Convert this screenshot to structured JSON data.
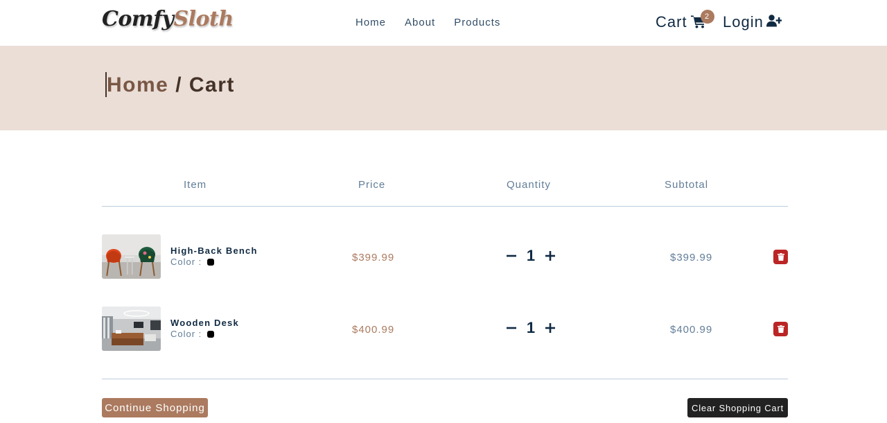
{
  "brand": {
    "part1": "Comfy",
    "part2": "Sloth"
  },
  "nav": {
    "links": [
      {
        "label": "Home"
      },
      {
        "label": "About"
      },
      {
        "label": "Products"
      }
    ],
    "cart_label": "Cart",
    "cart_count": "2",
    "login_label": "Login"
  },
  "hero": {
    "crumb_home": "Home",
    "separator": " / ",
    "current": "Cart"
  },
  "table": {
    "headers": {
      "item": "Item",
      "price": "Price",
      "quantity": "Quantity",
      "subtotal": "Subtotal"
    },
    "rows": [
      {
        "name": "High-Back Bench",
        "color_label": "Color :",
        "color": "#000000",
        "price": "$399.99",
        "quantity": "1",
        "subtotal": "$399.99"
      },
      {
        "name": "Wooden Desk",
        "color_label": "Color :",
        "color": "#000000",
        "price": "$400.99",
        "quantity": "1",
        "subtotal": "$400.99"
      }
    ]
  },
  "actions": {
    "continue_label": "Continue Shopping",
    "clear_label": "Clear Shopping Cart"
  },
  "icons": {
    "cart": "shopping-cart-icon",
    "login": "user-plus-icon",
    "minus": "minus-icon",
    "plus": "plus-icon",
    "delete": "trash-icon"
  },
  "colors": {
    "accent": "#ab7a5f",
    "hero_bg": "#eaded7",
    "hero_text": "#453227",
    "text_dark": "#102a42",
    "text_muted": "#617d98",
    "danger": "#bb2525",
    "button_dark": "#222222"
  }
}
